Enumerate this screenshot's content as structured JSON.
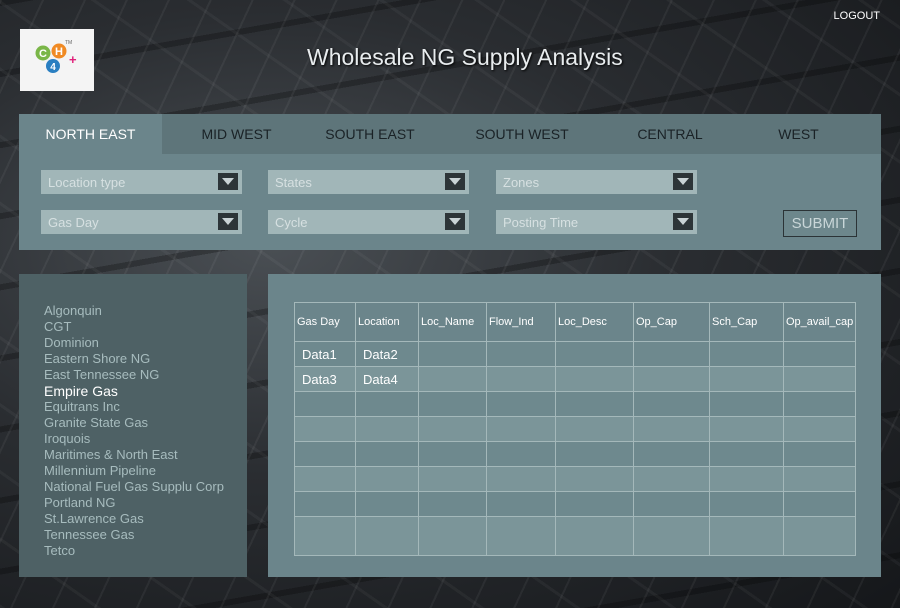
{
  "header": {
    "logout_label": "LOGOUT",
    "title": "Wholesale NG Supply Analysis",
    "logo": {
      "text": "CH4"
    }
  },
  "tabs": [
    {
      "label": "NORTH EAST",
      "active": true
    },
    {
      "label": "MID WEST",
      "active": false
    },
    {
      "label": "SOUTH EAST",
      "active": false
    },
    {
      "label": "SOUTH WEST",
      "active": false
    },
    {
      "label": "CENTRAL",
      "active": false
    },
    {
      "label": "WEST",
      "active": false
    }
  ],
  "filters": {
    "location_type": "Location type",
    "states": "States",
    "zones": "Zones",
    "gas_day": "Gas Day",
    "cycle": "Cycle",
    "posting_time": "Posting Time",
    "submit_label": "SUBMIT"
  },
  "pipelines": {
    "selected": "Empire Gas",
    "items": [
      "Algonquin",
      "CGT",
      "Dominion",
      "Eastern Shore NG",
      "East Tennessee NG",
      "Empire Gas",
      "Equitrans Inc",
      "Granite State Gas",
      "Iroquois",
      "Maritimes & North East",
      "Millennium Pipeline",
      "National Fuel Gas Supplu Corp",
      "Portland NG",
      "St.Lawrence Gas",
      "Tennessee Gas",
      "Tetco"
    ]
  },
  "table": {
    "columns": [
      "Gas Day",
      "Location",
      "Loc_Name",
      "Flow_Ind",
      "Loc_Desc",
      "Op_Cap",
      "Sch_Cap",
      "Op_avail_cap"
    ],
    "rows": [
      [
        "Data1",
        "Data2",
        "",
        "",
        "",
        "",
        "",
        ""
      ],
      [
        "Data3",
        "Data4",
        "",
        "",
        "",
        "",
        "",
        ""
      ],
      [
        "",
        "",
        "",
        "",
        "",
        "",
        "",
        ""
      ],
      [
        "",
        "",
        "",
        "",
        "",
        "",
        "",
        ""
      ],
      [
        "",
        "",
        "",
        "",
        "",
        "",
        "",
        ""
      ],
      [
        "",
        "",
        "",
        "",
        "",
        "",
        "",
        ""
      ],
      [
        "",
        "",
        "",
        "",
        "",
        "",
        "",
        ""
      ],
      [
        "",
        "",
        "",
        "",
        "",
        "",
        "",
        ""
      ]
    ]
  },
  "colors": {
    "panel": "#6b858b",
    "tab_bar": "#5e757a",
    "side_panel": "#4e6165",
    "dropdown": "#a1b6b8",
    "logo_green": "#7ab648",
    "logo_orange": "#f08a24",
    "logo_blue": "#2a7fc1",
    "logo_pink": "#e0207a"
  }
}
